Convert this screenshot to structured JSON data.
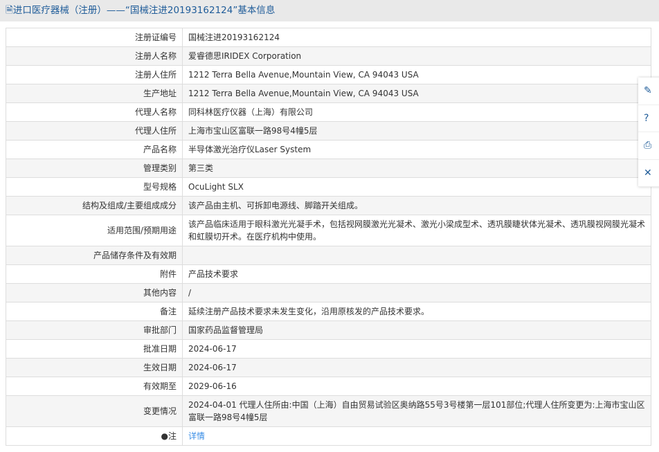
{
  "title": "进口医疗器械（注册）——“国械注进20193162124”基本信息",
  "rows": [
    {
      "label": "注册证编号",
      "value": "国械注进20193162124"
    },
    {
      "label": "注册人名称",
      "value": "爱睿德思IRIDEX Corporation"
    },
    {
      "label": "注册人住所",
      "value": "1212 Terra Bella Avenue,Mountain View, CA 94043 USA"
    },
    {
      "label": "生产地址",
      "value": "1212 Terra Bella Avenue,Mountain View, CA 94043 USA"
    },
    {
      "label": "代理人名称",
      "value": "同科林医疗仪器（上海）有限公司"
    },
    {
      "label": "代理人住所",
      "value": "上海市宝山区富联一路98号4幢5层"
    },
    {
      "label": "产品名称",
      "value": "半导体激光治疗仪Laser System"
    },
    {
      "label": "管理类别",
      "value": "第三类"
    },
    {
      "label": "型号规格",
      "value": "OcuLight SLX"
    },
    {
      "label": "结构及组成/主要组成成分",
      "value": "该产品由主机、可拆卸电源线、脚踏开关组成。"
    },
    {
      "label": "适用范围/预期用途",
      "value": "该产品临床适用于眼科激光光凝手术，包括视网膜激光光凝术、激光小梁成型术、透巩膜睫状体光凝术、透巩膜视网膜光凝术和虹膜切开术。在医疗机构中使用。"
    },
    {
      "label": "产品储存条件及有效期",
      "value": ""
    },
    {
      "label": "附件",
      "value": "产品技术要求"
    },
    {
      "label": "其他内容",
      "value": "/"
    },
    {
      "label": "备注",
      "value": "延续注册产品技术要求未发生变化，沿用原核发的产品技术要求。"
    },
    {
      "label": "审批部门",
      "value": "国家药品监督管理局"
    },
    {
      "label": "批准日期",
      "value": "2024-06-17"
    },
    {
      "label": "生效日期",
      "value": "2024-06-17"
    },
    {
      "label": "有效期至",
      "value": "2029-06-16"
    },
    {
      "label": "变更情况",
      "value": "2024-04-01 代理人住所由:中国（上海）自由贸易试验区奥纳路55号3号楼第一层101部位;代理人住所变更为:上海市宝山区富联一路98号4幢5层"
    }
  ],
  "note": {
    "label": "注",
    "link": "详情"
  },
  "side": [
    {
      "icon": "edit-icon",
      "glyph": "✎"
    },
    {
      "icon": "help-icon",
      "glyph": "?"
    },
    {
      "icon": "print-icon",
      "glyph": "⎙"
    },
    {
      "icon": "close-icon",
      "glyph": "✕"
    }
  ]
}
